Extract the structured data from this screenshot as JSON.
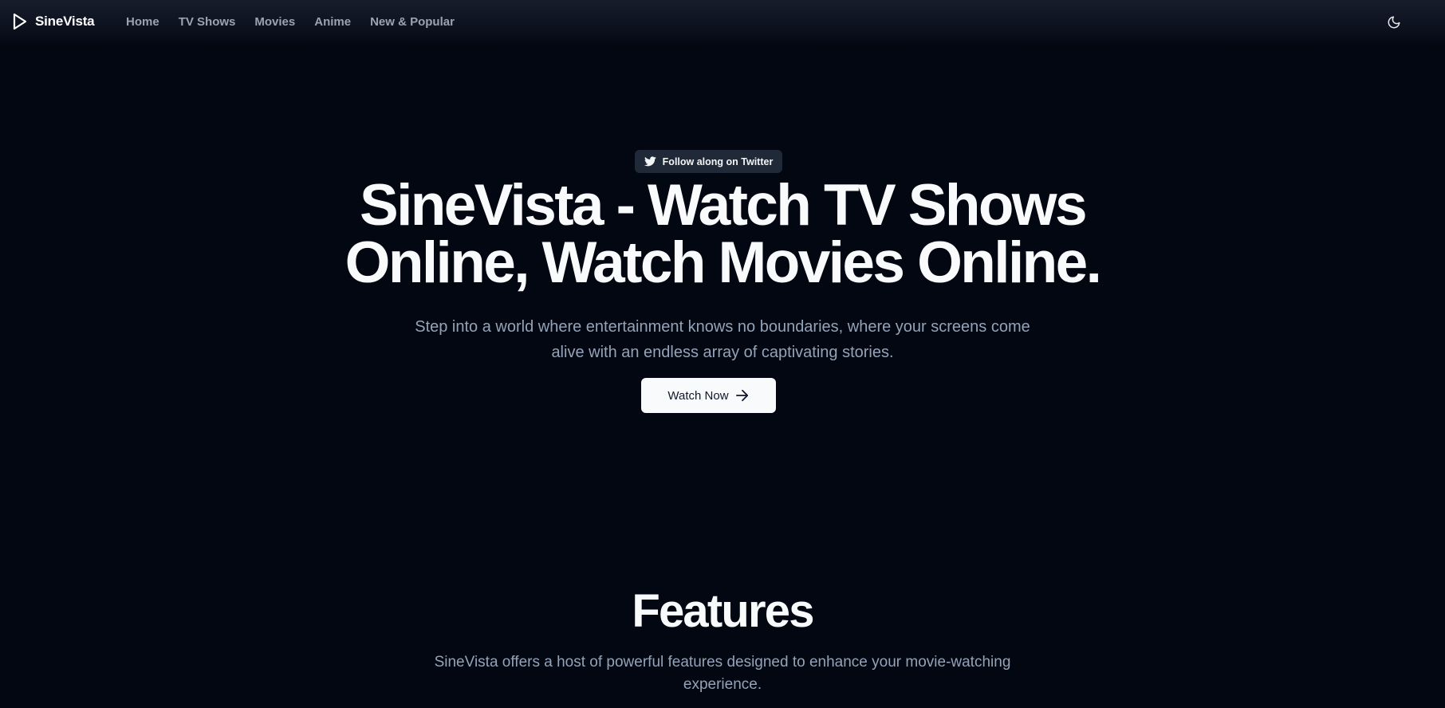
{
  "header": {
    "brand": "SineVista",
    "nav": [
      {
        "label": "Home"
      },
      {
        "label": "TV Shows"
      },
      {
        "label": "Movies"
      },
      {
        "label": "Anime"
      },
      {
        "label": "New & Popular"
      }
    ],
    "theme_icon": "moon-icon"
  },
  "hero": {
    "badge_label": "Follow along on Twitter",
    "badge_icon": "twitter-icon",
    "title": "SineVista - Watch TV Shows Online, Watch Movies Online.",
    "subtitle": "Step into a world where entertainment knows no boundaries, where your screens come alive with an endless array of captivating stories.",
    "cta_label": "Watch Now",
    "cta_icon": "arrow-right-icon"
  },
  "features": {
    "title": "Features",
    "subtitle": "SineVista offers a host of powerful features designed to enhance your movie-watching experience."
  },
  "colors": {
    "background": "#030712",
    "text": "#f8fafc",
    "muted": "#94a3b8",
    "badge_bg": "#1f2937"
  }
}
